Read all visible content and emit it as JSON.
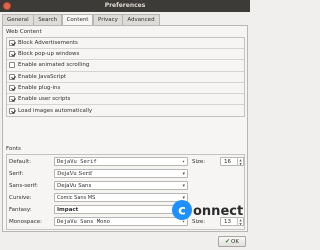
{
  "window": {
    "title": "Preferences"
  },
  "tabs": [
    {
      "label": "General"
    },
    {
      "label": "Search"
    },
    {
      "label": "Content"
    },
    {
      "label": "Privacy"
    },
    {
      "label": "Advanced"
    }
  ],
  "web_content": {
    "title": "Web Content",
    "options": [
      {
        "label": "Block Advertisements",
        "checked": true
      },
      {
        "label": "Block pop-up windows",
        "checked": true
      },
      {
        "label": "Enable animated scrolling",
        "checked": false
      },
      {
        "label": "Enable JavaScript",
        "checked": true
      },
      {
        "label": "Enable plug-ins",
        "checked": true
      },
      {
        "label": "Enable user scripts",
        "checked": true
      },
      {
        "label": "Load images automatically",
        "checked": true
      }
    ]
  },
  "fonts": {
    "title": "Fonts",
    "rows": [
      {
        "label": "Default:",
        "value": "DejaVu Serif",
        "size_label": "Size:",
        "size": "16"
      },
      {
        "label": "Serif:",
        "value": "DejaVu Serif"
      },
      {
        "label": "Sans-serif:",
        "value": "DejaVu Sans"
      },
      {
        "label": "Cursive:",
        "value": "Comic Sans MS"
      },
      {
        "label": "Fantasy:",
        "value": "Impact"
      },
      {
        "label": "Monospace:",
        "value": "DejaVu Sans Mono",
        "size_label": "Size:",
        "size": "13"
      }
    ]
  },
  "footer": {
    "ok_label": "OK"
  },
  "watermark": {
    "text": "onnect",
    "letter": "c",
    "accent": "#1e90ff"
  }
}
